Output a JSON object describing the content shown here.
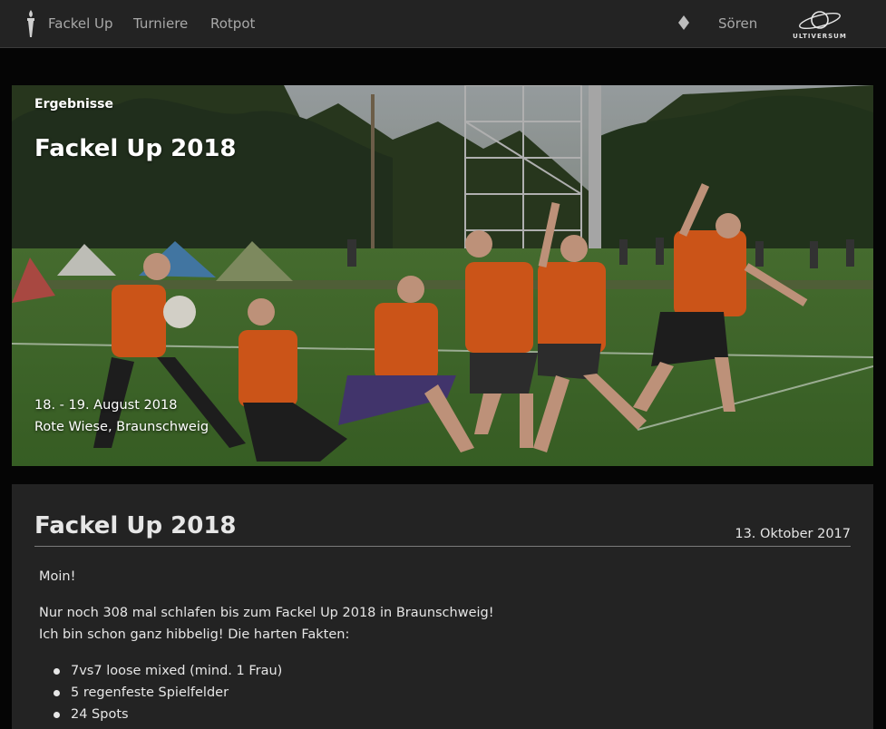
{
  "navbar": {
    "brand_icon": "torch-icon",
    "brand_label": "Fackel Up",
    "links": [
      "Turniere",
      "Rotpot"
    ],
    "user_icon": "diamond-icon",
    "user_label": "Sören",
    "logo_icon": "ultiversum-planet-logo",
    "logo_text": "ULTIVERSUM"
  },
  "hero": {
    "kicker": "Ergebnisse",
    "title": "Fackel Up 2018",
    "date": "18. - 19. August 2018",
    "place": "Rote Wiese, Braunschweig",
    "image": "team-photo-players-posing-on-field"
  },
  "post": {
    "title": "Fackel Up 2018",
    "date": "13. Oktober 2017",
    "greeting": "Moin!",
    "para_line1": "Nur noch 308 mal schlafen bis zum Fackel Up 2018 in Braunschweig!",
    "para_line2": "Ich bin schon ganz hibbelig! Die harten Fakten:",
    "facts": [
      "7vs7 loose mixed (mind. 1 Frau)",
      "5 regenfeste Spielfelder",
      "24 Spots"
    ]
  },
  "colors": {
    "navbar_bg": "#232323",
    "page_bg": "#050505",
    "card_bg": "#232323",
    "jersey_orange": "#e8601c"
  }
}
